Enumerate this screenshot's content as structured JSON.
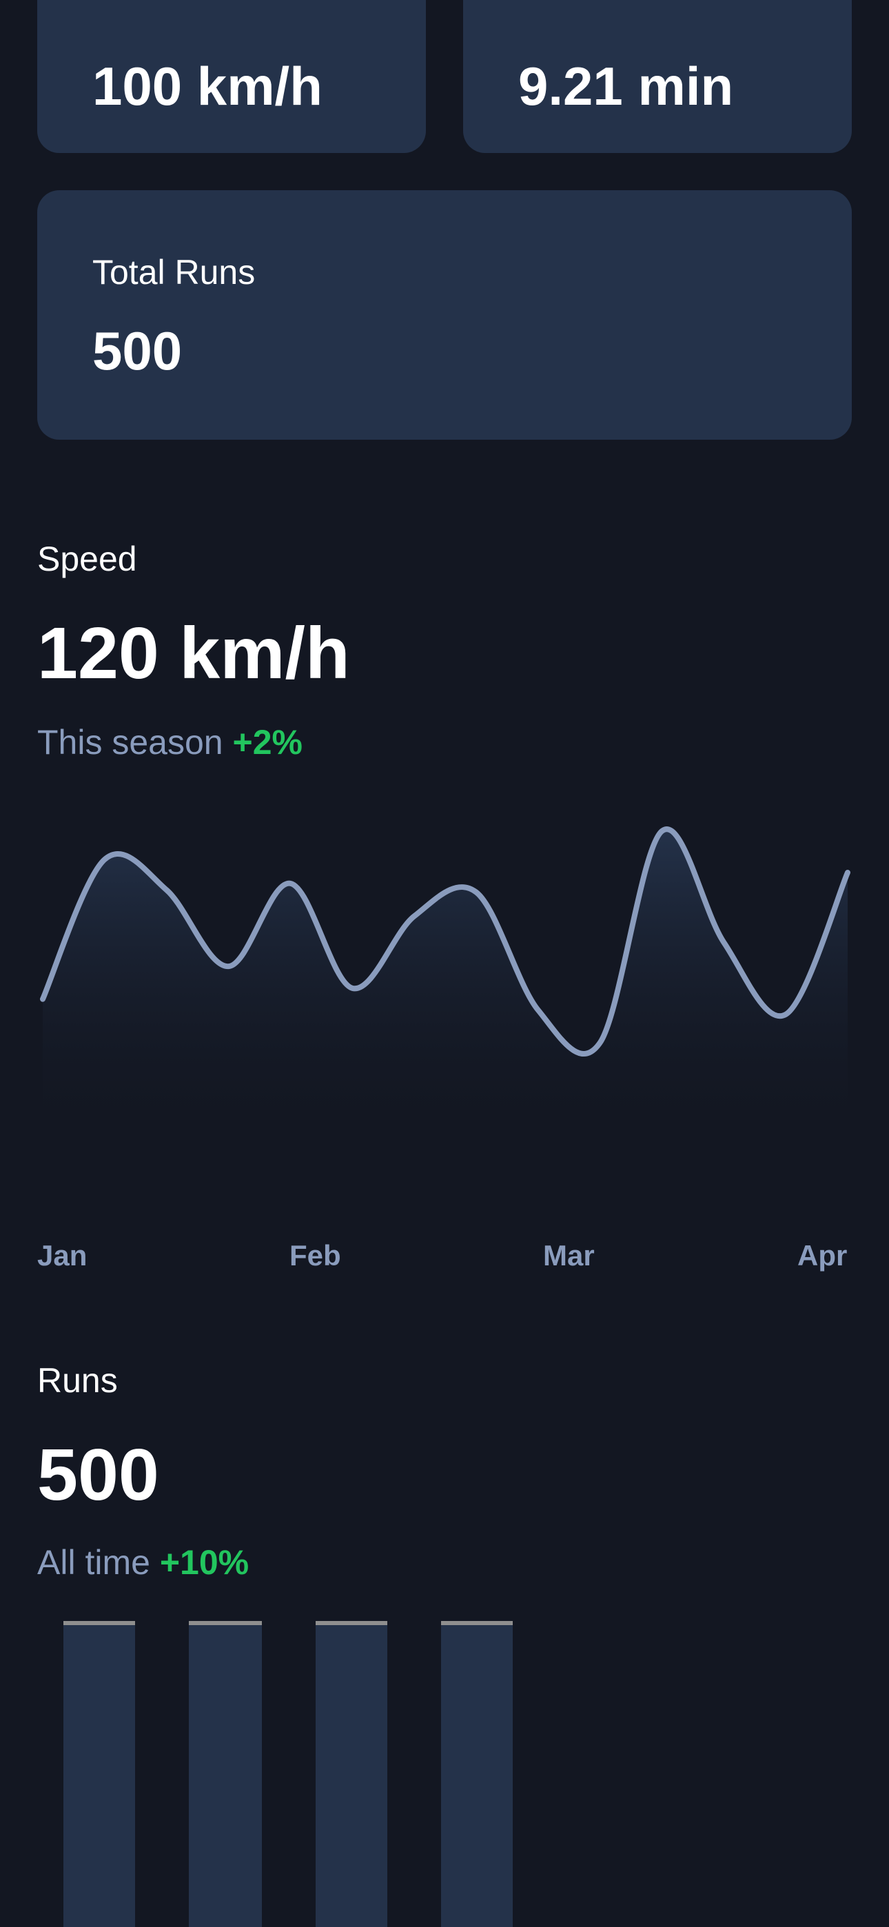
{
  "stats": {
    "top_speed_value": "100 km/h",
    "avg_time_value": "9.21 min",
    "total_runs_label": "Total Runs",
    "total_runs_value": "500"
  },
  "speed_section": {
    "label": "Speed",
    "value": "120 km/h",
    "period": "This season",
    "delta": "+2%"
  },
  "runs_section": {
    "label": "Runs",
    "value": "500",
    "period": "All time",
    "delta": "+10%"
  },
  "colors": {
    "background": "#131722",
    "card": "#24324a",
    "line": "#8a9cbd",
    "positive": "#22c55e"
  },
  "chart_data": [
    {
      "type": "line",
      "x_tick_labels": [
        "Jan",
        "Feb",
        "Mar",
        "Apr"
      ],
      "values": [
        38,
        102,
        88,
        53,
        91,
        43,
        76,
        87,
        33,
        18,
        115,
        64,
        31,
        96
      ],
      "ylim": [
        0,
        120
      ],
      "grid": false
    },
    {
      "type": "bar",
      "values": [
        1,
        1,
        1,
        1
      ],
      "ylim": [
        0,
        1
      ]
    }
  ]
}
